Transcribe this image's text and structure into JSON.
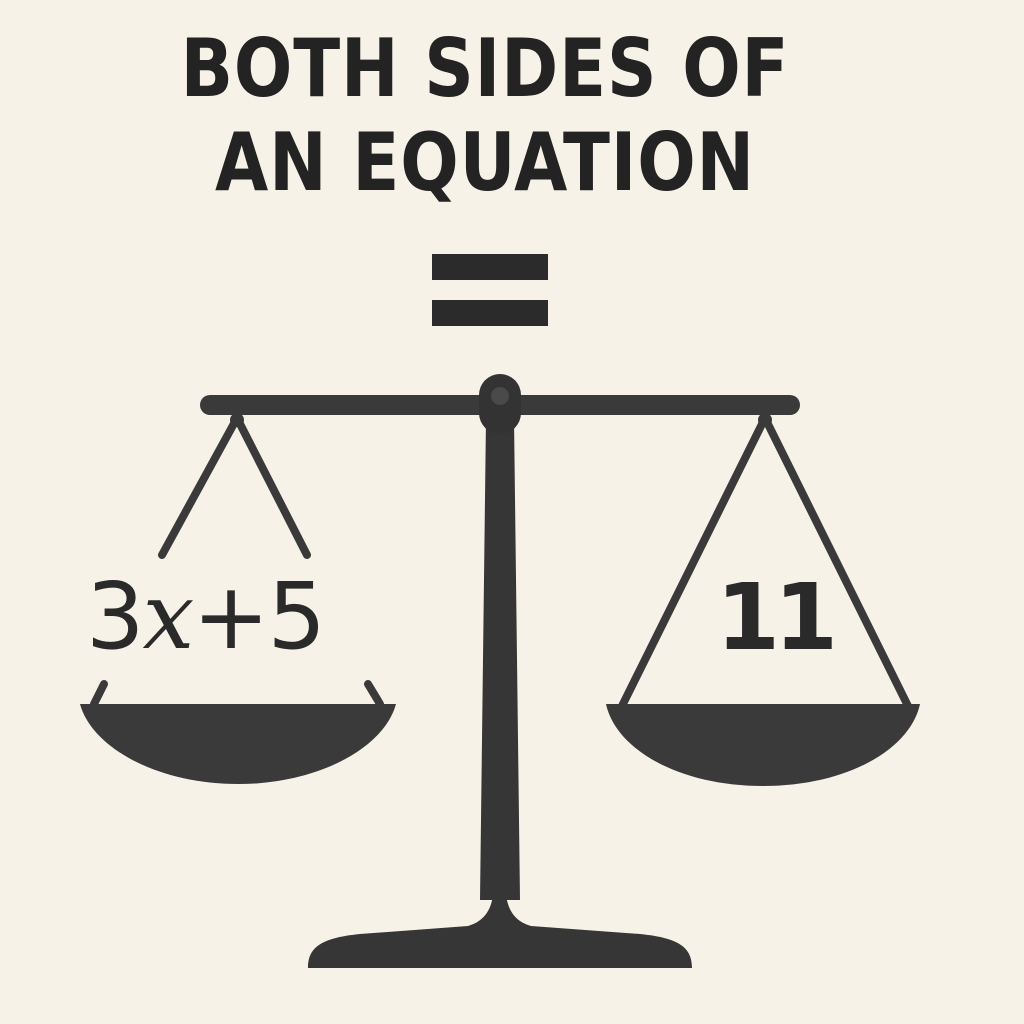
{
  "title": {
    "line1": "BOTH SIDES OF",
    "line2": "AN EQUATION"
  },
  "equals_symbol": "=",
  "left_pan": {
    "coefficient": "3",
    "variable": "x",
    "operator": "+",
    "constant": "5"
  },
  "right_pan": {
    "value": "11"
  },
  "colors": {
    "background": "#f7f2e8",
    "ink": "#2a2a2a",
    "scale": "#363636",
    "pan": "#3a3a3a"
  }
}
